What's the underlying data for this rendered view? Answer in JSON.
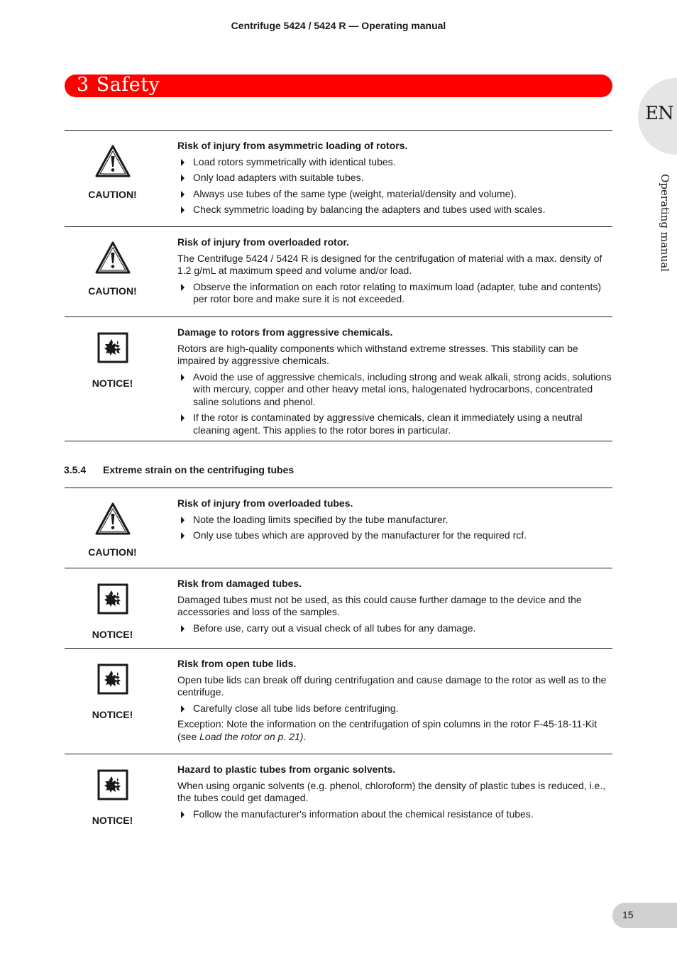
{
  "header": {
    "running_title": "Centrifuge 5424 / 5424 R  —  Operating manual"
  },
  "chapter": {
    "number": "3",
    "title": "Safety",
    "color": "#ff0000"
  },
  "side_tab": {
    "language": "EN",
    "label": "Operating manual"
  },
  "blocks_a": [
    {
      "sign": "CAUTION!",
      "icon": "warning-triangle-icon",
      "title": "Risk of injury from asymmetric loading of rotors.",
      "paragraphs": [],
      "bullets": [
        "Load rotors symmetrically with identical tubes.",
        "Only load adapters with suitable tubes.",
        "Always use tubes of the same type (weight, material/density and volume).",
        "Check symmetric loading by balancing the adapters and tubes used with scales."
      ]
    },
    {
      "sign": "CAUTION!",
      "icon": "warning-triangle-icon",
      "title": "Risk of injury from overloaded rotor.",
      "paragraphs": [
        "The Centrifuge 5424 / 5424 R is designed for the centrifugation of material with a max. density of 1.2 g/mL at maximum speed and volume and/or load."
      ],
      "bullets": [
        "Observe the information on each rotor relating to maximum load (adapter, tube and contents) per rotor bore and make sure it is not exceeded."
      ]
    },
    {
      "sign": "NOTICE!",
      "icon": "notice-damage-icon",
      "title": "Damage to rotors from aggressive chemicals.",
      "paragraphs": [
        "Rotors are high-quality components which withstand extreme stresses. This stability can be impaired by aggressive chemicals."
      ],
      "bullets": [
        "Avoid the use of aggressive chemicals, including strong and weak alkali, strong acids, solutions with mercury, copper and other heavy metal ions, halogenated hydrocarbons, concentrated saline solutions and phenol.",
        "If the rotor is contaminated by aggressive chemicals, clean it immediately using a neutral cleaning agent. This applies to the rotor bores in particular."
      ]
    }
  ],
  "section": {
    "number": "3.5.4",
    "title": "Extreme strain on the centrifuging tubes"
  },
  "blocks_b": [
    {
      "sign": "CAUTION!",
      "icon": "warning-triangle-icon",
      "title": "Risk of injury from overloaded tubes.",
      "paragraphs": [],
      "bullets": [
        "Note the loading limits specified by the tube manufacturer.",
        "Only use tubes which are approved by the manufacturer for the required rcf."
      ]
    },
    {
      "sign": "NOTICE!",
      "icon": "notice-damage-icon",
      "title": "Risk from damaged tubes.",
      "paragraphs": [
        "Damaged tubes must not be used, as this could cause further damage to the device and the accessories and loss of the samples."
      ],
      "bullets": [
        "Before use, carry out a visual check of all tubes for any damage."
      ]
    },
    {
      "sign": "NOTICE!",
      "icon": "notice-damage-icon",
      "title": "Risk from open tube lids.",
      "paragraphs": [
        "Open tube lids can break off during centrifugation and cause damage to the rotor as well as to the centrifuge."
      ],
      "bullets": [
        "Carefully close all tube lids before centrifuging."
      ],
      "after": {
        "prefix": "Exception: Note the information on the centrifugation of spin columns in the rotor F-45-18-11-Kit (see ",
        "link": "Load the rotor on p. 21)",
        "suffix": "."
      }
    },
    {
      "sign": "NOTICE!",
      "icon": "notice-damage-icon",
      "title": "Hazard to plastic tubes from organic solvents.",
      "paragraphs": [
        "When using organic solvents (e.g. phenol, chloroform) the density of plastic tubes is reduced, i.e., the tubes could get damaged."
      ],
      "bullets": [
        "Follow the manufacturer's information about the chemical resistance of tubes."
      ]
    }
  ],
  "footer": {
    "page_number": "15"
  }
}
